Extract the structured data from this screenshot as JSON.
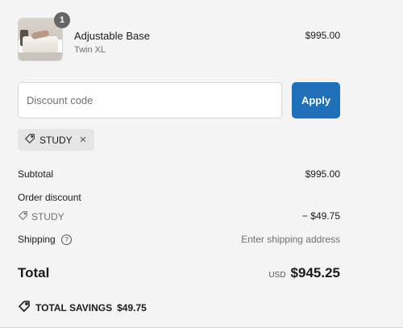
{
  "line_item": {
    "quantity": "1",
    "name": "Adjustable Base",
    "variant": "Twin XL",
    "price": "$995.00"
  },
  "discount": {
    "placeholder": "Discount code",
    "value": "",
    "apply_label": "Apply",
    "applied_code": "STUDY",
    "remove_symbol": "×"
  },
  "summary": {
    "subtotal_label": "Subtotal",
    "subtotal_value": "$995.00",
    "order_discount_label": "Order discount",
    "discount_code": "STUDY",
    "discount_value": "− $49.75",
    "shipping_label": "Shipping",
    "shipping_help_symbol": "?",
    "shipping_value": "Enter shipping address",
    "total_label": "Total",
    "currency": "USD",
    "total_value": "$945.25",
    "savings_label": "TOTAL SAVINGS",
    "savings_value": "$49.75"
  },
  "colors": {
    "background": "#f4f4f4",
    "accent": "#1f70b8",
    "muted_text": "#707070"
  },
  "icons": {
    "thumbnail": "product-thumbnail",
    "tag": "tag-icon",
    "remove": "close-icon",
    "help": "question-circle-icon",
    "savings": "tag-icon"
  }
}
